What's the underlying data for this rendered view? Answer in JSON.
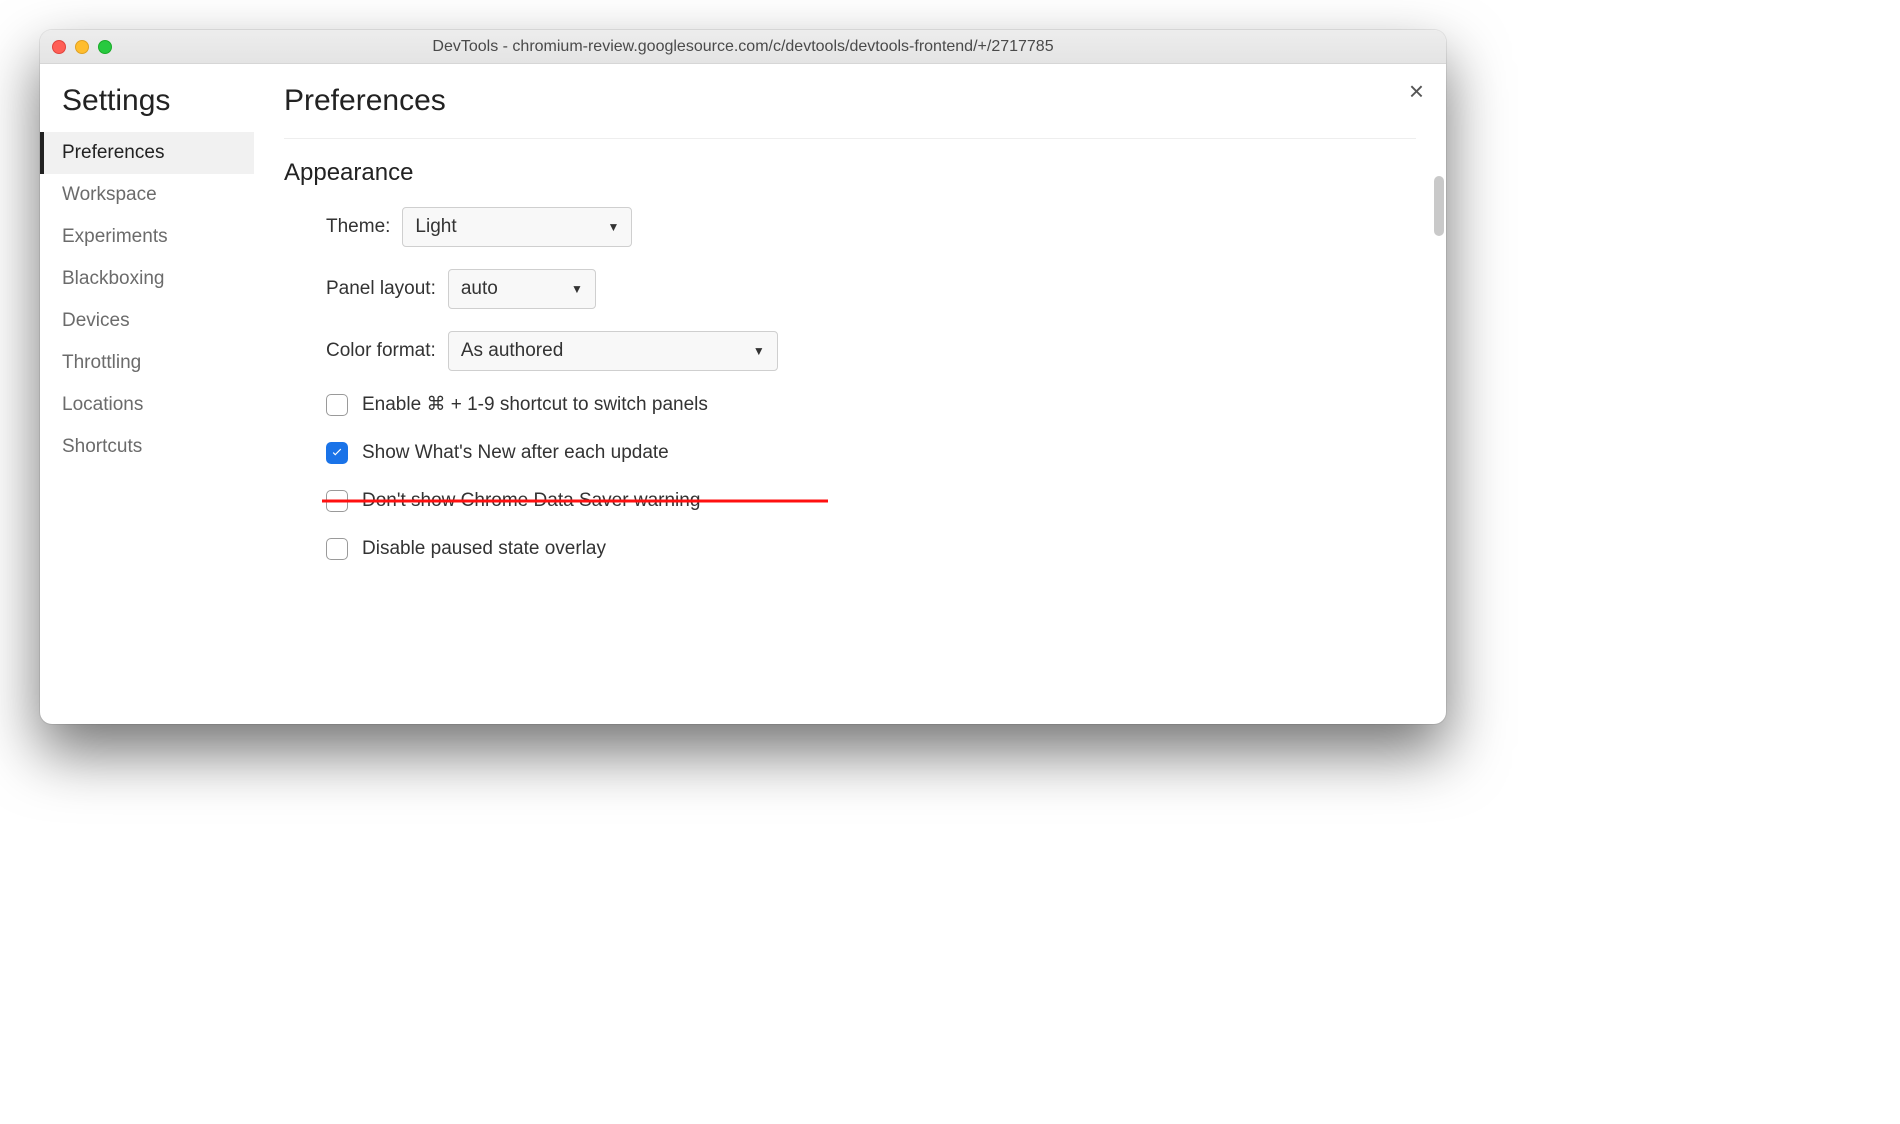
{
  "window": {
    "title": "DevTools - chromium-review.googlesource.com/c/devtools/devtools-frontend/+/2717785"
  },
  "sidebar": {
    "title": "Settings",
    "items": [
      {
        "label": "Preferences",
        "selected": true
      },
      {
        "label": "Workspace"
      },
      {
        "label": "Experiments"
      },
      {
        "label": "Blackboxing"
      },
      {
        "label": "Devices"
      },
      {
        "label": "Throttling"
      },
      {
        "label": "Locations"
      },
      {
        "label": "Shortcuts"
      }
    ]
  },
  "main": {
    "title": "Preferences",
    "close_label": "×",
    "section": {
      "title": "Appearance",
      "theme_label": "Theme:",
      "theme_value": "Light",
      "panel_layout_label": "Panel layout:",
      "panel_layout_value": "auto",
      "color_format_label": "Color format:",
      "color_format_value": "As authored",
      "checks": [
        {
          "label": "Enable ⌘ + 1-9 shortcut to switch panels",
          "checked": false,
          "strikethrough": false
        },
        {
          "label": "Show What's New after each update",
          "checked": true,
          "strikethrough": false
        },
        {
          "label": "Don't show Chrome Data Saver warning",
          "checked": false,
          "strikethrough": true
        },
        {
          "label": "Disable paused state overlay",
          "checked": false,
          "strikethrough": false
        }
      ]
    }
  }
}
